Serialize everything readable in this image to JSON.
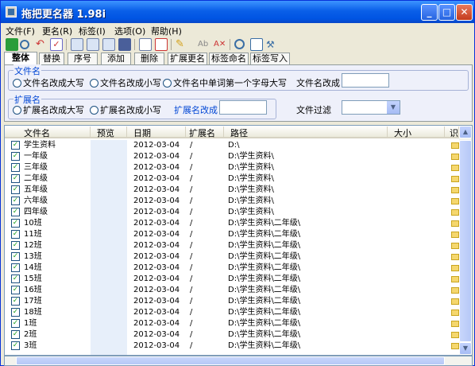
{
  "window": {
    "title": "拖把更名器 1.98i"
  },
  "menu": [
    "文件(F)",
    "更名(R)",
    "标签(I)",
    "选项(O)",
    "帮助(H)"
  ],
  "tabs": [
    "整体",
    "替换",
    "序号",
    "添加",
    "删除",
    "扩展更名",
    "标签命名",
    "标签写入"
  ],
  "filename_group": {
    "title": "文件名",
    "options": [
      "文件名改成大写",
      "文件名改成小写",
      "文件名中单词第一个字母大写"
    ],
    "change_label": "文件名改成"
  },
  "ext_group": {
    "title": "扩展名",
    "options": [
      "扩展名改成大写",
      "扩展名改成小写"
    ],
    "change_label": "扩展名改成"
  },
  "filter_label": "文件过滤",
  "grid": {
    "columns": [
      "文件名",
      "预览",
      "日期",
      "扩展名",
      "路径",
      "大小",
      "识别"
    ],
    "rows": [
      {
        "name": "学生资料",
        "date": "2012-03-04",
        "ext": "/",
        "path": "D:\\"
      },
      {
        "name": "一年级",
        "date": "2012-03-04",
        "ext": "/",
        "path": "D:\\学生资料\\"
      },
      {
        "name": "三年级",
        "date": "2012-03-04",
        "ext": "/",
        "path": "D:\\学生资料\\"
      },
      {
        "name": "二年级",
        "date": "2012-03-04",
        "ext": "/",
        "path": "D:\\学生资料\\"
      },
      {
        "name": "五年级",
        "date": "2012-03-04",
        "ext": "/",
        "path": "D:\\学生资料\\"
      },
      {
        "name": "六年级",
        "date": "2012-03-04",
        "ext": "/",
        "path": "D:\\学生资料\\"
      },
      {
        "name": "四年级",
        "date": "2012-03-04",
        "ext": "/",
        "path": "D:\\学生资料\\"
      },
      {
        "name": "10班",
        "date": "2012-03-04",
        "ext": "/",
        "path": "D:\\学生资料\\二年级\\"
      },
      {
        "name": "11班",
        "date": "2012-03-04",
        "ext": "/",
        "path": "D:\\学生资料\\二年级\\"
      },
      {
        "name": "12班",
        "date": "2012-03-04",
        "ext": "/",
        "path": "D:\\学生资料\\二年级\\"
      },
      {
        "name": "13班",
        "date": "2012-03-04",
        "ext": "/",
        "path": "D:\\学生资料\\二年级\\"
      },
      {
        "name": "14班",
        "date": "2012-03-04",
        "ext": "/",
        "path": "D:\\学生资料\\二年级\\"
      },
      {
        "name": "15班",
        "date": "2012-03-04",
        "ext": "/",
        "path": "D:\\学生资料\\二年级\\"
      },
      {
        "name": "16班",
        "date": "2012-03-04",
        "ext": "/",
        "path": "D:\\学生资料\\二年级\\"
      },
      {
        "name": "17班",
        "date": "2012-03-04",
        "ext": "/",
        "path": "D:\\学生资料\\二年级\\"
      },
      {
        "name": "18班",
        "date": "2012-03-04",
        "ext": "/",
        "path": "D:\\学生资料\\二年级\\"
      },
      {
        "name": "1班",
        "date": "2012-03-04",
        "ext": "/",
        "path": "D:\\学生资料\\二年级\\"
      },
      {
        "name": "2班",
        "date": "2012-03-04",
        "ext": "/",
        "path": "D:\\学生资料\\二年级\\"
      },
      {
        "name": "3班",
        "date": "2012-03-04",
        "ext": "/",
        "path": "D:\\学生资料\\二年级\\"
      }
    ]
  },
  "toolbar_icons": [
    "refresh-icon",
    "search-icon",
    "undo-icon",
    "check-icon",
    "copy-icon",
    "paste-icon",
    "cut-icon",
    "save-icon",
    "document-icon",
    "list-icon",
    "pencil-icon",
    "rename-icon",
    "rename-a-icon",
    "clock-icon",
    "window-icon",
    "tools-icon"
  ],
  "colors": {
    "titlebar": "#0054e3",
    "group_title": "#0046d5",
    "folder": "#f5d76e"
  }
}
